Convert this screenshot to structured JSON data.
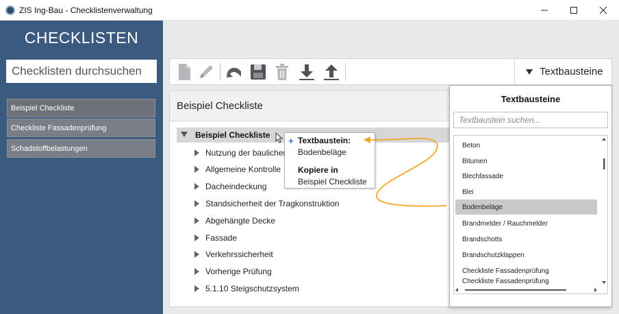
{
  "window": {
    "title": "ZIS Ing-Bau - Checklistenverwaltung",
    "min_glyph": "—",
    "max_glyph": "☐",
    "close_glyph": "✕"
  },
  "sidebar": {
    "title": "CHECKLISTEN",
    "search_placeholder": "Checklisten durchsuchen",
    "items": [
      {
        "label": "Beispiel Checkliste",
        "active": true
      },
      {
        "label": "Checkliste Fassadenprüfung",
        "active": false
      },
      {
        "label": "Schadstoffbelastungen",
        "active": false
      }
    ]
  },
  "toolbar": {
    "icons": [
      "new-document-icon",
      "edit-pencil-icon",
      "undo-icon",
      "save-disk-icon",
      "delete-trash-icon",
      "import-down-arrow-icon",
      "export-up-arrow-icon"
    ],
    "textbausteine_label": "Textbausteine"
  },
  "panel": {
    "header": "Beispiel Checkliste",
    "root_label": "Beispiel Checkliste",
    "items": [
      "Nutzung der baulichen A",
      "Allgemeine Kontrolle",
      "Dacheindeckung",
      "Standsicherheit der Tragkonstruktion",
      "Abgehängte Decke",
      "Fassade",
      "Verkehrssicherheit",
      "Vorherige Prüfung",
      "5.1.10 Steigschutzsystem"
    ]
  },
  "context_popup": {
    "plus": "+",
    "line1": "Textbaustein:",
    "line2": "Bodenbeläge",
    "line3": "Kopiere in",
    "line4": "Beispiel Checkliste"
  },
  "flyout": {
    "title": "Textbausteine",
    "search_placeholder": "Textbaustein suchen...",
    "selected": "Bodenbeläge",
    "items": [
      "Beton",
      "Bitumen",
      "Blechfassade",
      "Blei",
      "Bodenbeläge",
      "Brandmelder / Rauchmelder",
      "Brandschotts",
      "Brandschutzklappen",
      "Checkliste Fassadenprüfung",
      "Checkliste Fassadenprüfung"
    ]
  },
  "colors": {
    "sidebar_bg": "#3a5a80",
    "accent_arrow": "#f5a623",
    "plus_blue": "#2a6fd4"
  }
}
